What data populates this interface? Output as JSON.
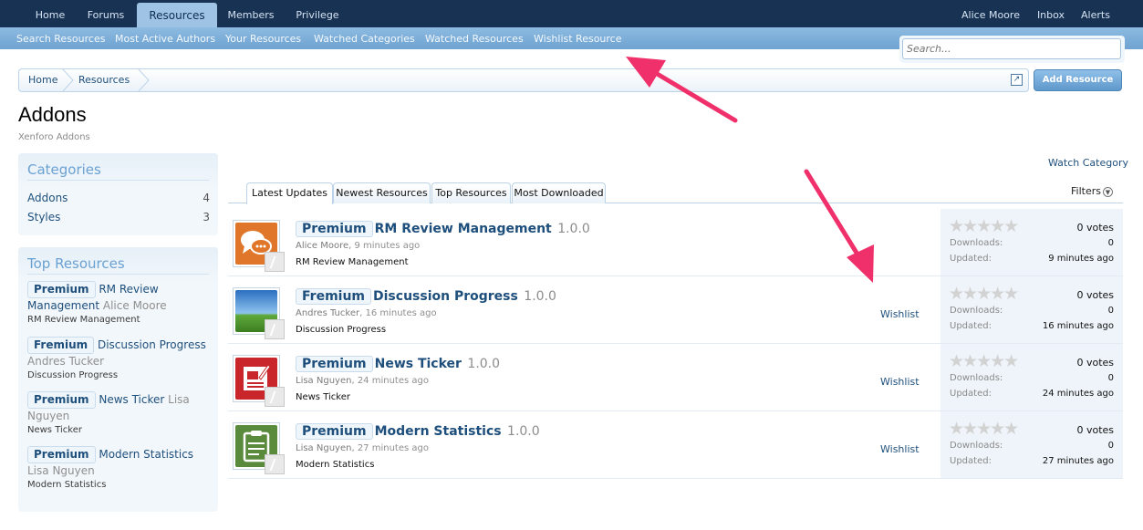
{
  "nav": {
    "tabs": [
      "Home",
      "Forums",
      "Resources",
      "Members",
      "Privilege"
    ],
    "active": "Resources",
    "right": [
      "Alice Moore",
      "Inbox",
      "Alerts"
    ]
  },
  "subnav": [
    "Search Resources",
    "Most Active Authors",
    "Your Resources",
    "Watched Categories",
    "Watched Resources",
    "Wishlist Resource"
  ],
  "search": {
    "placeholder": "Search..."
  },
  "breadcrumb": [
    "Home",
    "Resources"
  ],
  "add_resource": "Add Resource",
  "page": {
    "title": "Addons",
    "subtitle": "Xenforo Addons"
  },
  "categories": {
    "heading": "Categories",
    "items": [
      {
        "name": "Addons",
        "count": "4"
      },
      {
        "name": "Styles",
        "count": "3"
      }
    ]
  },
  "top_resources": {
    "heading": "Top Resources",
    "items": [
      {
        "prefix": "Premium",
        "title": "RM Review Management",
        "author": "Alice Moore",
        "tag": "RM Review Management"
      },
      {
        "prefix": "Fremium",
        "title": "Discussion Progress",
        "author": "Andres Tucker",
        "tag": "Discussion Progress"
      },
      {
        "prefix": "Premium",
        "title": "News Ticker",
        "author": "Lisa Nguyen",
        "tag": "News Ticker"
      },
      {
        "prefix": "Premium",
        "title": "Modern Statistics",
        "author": "Lisa Nguyen",
        "tag": "Modern Statistics"
      }
    ]
  },
  "watch_category": "Watch Category",
  "filters": "Filters",
  "list_tabs": [
    "Latest Updates",
    "Newest Resources",
    "Top Resources",
    "Most Downloaded"
  ],
  "resources": [
    {
      "prefix": "Premium",
      "title": "RM Review Management",
      "version": "1.0.0",
      "author": "Alice Moore",
      "time": "9 minutes ago",
      "tag": "RM Review Management",
      "wishlist": "",
      "votes": "0 votes",
      "downloads_label": "Downloads:",
      "downloads": "0",
      "updated_label": "Updated:",
      "updated": "9 minutes ago",
      "rating": 0,
      "icon": "chat-bubbles-icon",
      "color": "#e0762a"
    },
    {
      "prefix": "Fremium",
      "title": "Discussion Progress",
      "version": "1.0.0",
      "author": "Andres Tucker",
      "time": "16 minutes ago",
      "tag": "Discussion Progress",
      "wishlist": "Wishlist",
      "votes": "0 votes",
      "downloads_label": "Downloads:",
      "downloads": "0",
      "updated_label": "Updated:",
      "updated": "16 minutes ago",
      "rating": 0,
      "icon": "landscape-icon",
      "color": "#3d7fc4"
    },
    {
      "prefix": "Premium",
      "title": "News Ticker",
      "version": "1.0.0",
      "author": "Lisa Nguyen",
      "time": "24 minutes ago",
      "tag": "News Ticker",
      "wishlist": "Wishlist",
      "votes": "0 votes",
      "downloads_label": "Downloads:",
      "downloads": "0",
      "updated_label": "Updated:",
      "updated": "24 minutes ago",
      "rating": 0,
      "icon": "newspaper-icon",
      "color": "#c9262b"
    },
    {
      "prefix": "Premium",
      "title": "Modern Statistics",
      "version": "1.0.0",
      "author": "Lisa Nguyen",
      "time": "27 minutes ago",
      "tag": "Modern Statistics",
      "wishlist": "Wishlist",
      "votes": "0 votes",
      "downloads_label": "Downloads:",
      "downloads": "0",
      "updated_label": "Updated:",
      "updated": "27 minutes ago",
      "rating": 0,
      "icon": "clipboard-icon",
      "color": "#5a8a3c"
    }
  ],
  "colors": {
    "nav": "#183254",
    "subnav": "#7aaedb",
    "link": "#1e4f7c",
    "annotation_arrow": "#f0306a"
  }
}
